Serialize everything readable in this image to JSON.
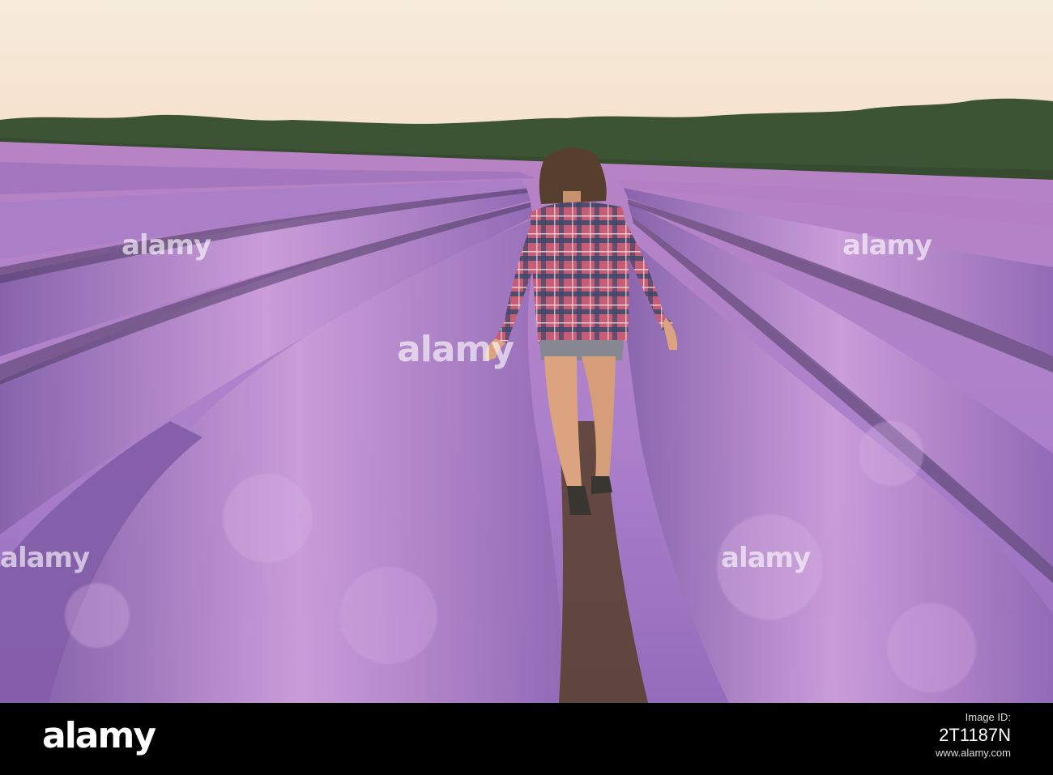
{
  "photo": {
    "subject": "woman-walking-lavender-field",
    "palette": {
      "sky_top": "#f5ecd6",
      "sky_bottom": "#f7e3cf",
      "trees": "#2f4a2b",
      "lavender_light": "#c08fd8",
      "lavender_mid": "#9a6cc4",
      "lavender_dark": "#5c3f86",
      "soil": "#4a3320",
      "shirt_red": "#b8496a",
      "shirt_blue": "#2d3b62",
      "hair": "#4a3426",
      "skin": "#d9a07e"
    }
  },
  "watermark": {
    "text": "alamy"
  },
  "footer": {
    "logo": "alamy",
    "label": "Image ID:",
    "id": "2T1187N",
    "url": "www.alamy.com"
  }
}
